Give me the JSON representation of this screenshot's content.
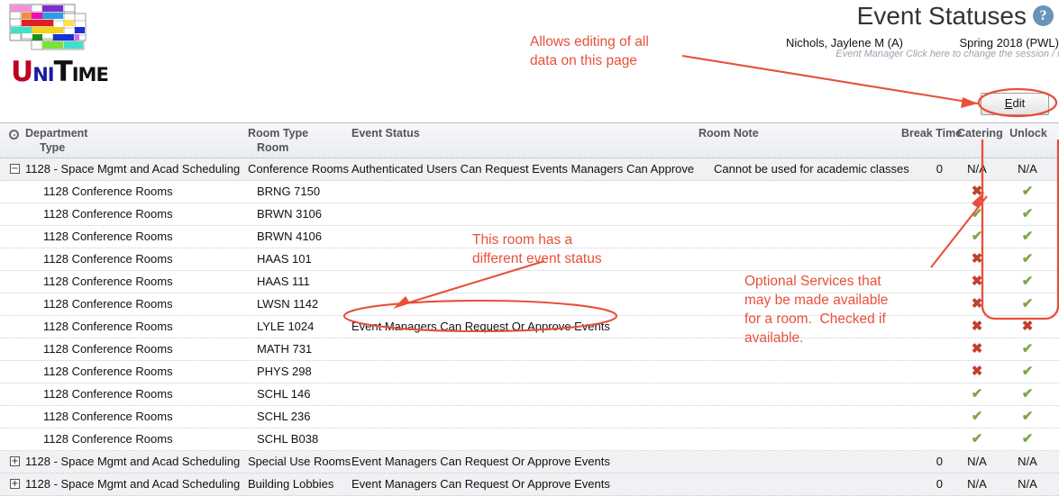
{
  "brand": {
    "name": "UniTime",
    "u": "U",
    "ni": "NI",
    "t": "T",
    "ime": "IME"
  },
  "header": {
    "title": "Event Statuses",
    "help_icon": "help-icon",
    "help_glyph": "?",
    "user_name": "Nichols, Jaylene M (A)",
    "user_role": "Event Manager",
    "session": "Spring 2018 (PWL)",
    "session_hint": "Click here to change the session / role."
  },
  "toolbar": {
    "edit_label": "Edit",
    "edit_accesskey": "E",
    "edit_rest": "dit"
  },
  "table": {
    "headers": {
      "department": "Department",
      "type": "Type",
      "room_type": "Room Type",
      "room": "Room",
      "event_status": "Event Status",
      "room_note": "Room Note",
      "break_time": "Break Time",
      "catering": "Catering",
      "unlock": "Unlock"
    },
    "groups": [
      {
        "expander": "−",
        "expanded": true,
        "label": "1128 - Space Mgmt and Acad Scheduling",
        "room_type": "Conference Rooms",
        "event_status": "Authenticated Users Can Request Events Managers Can Approve",
        "room_note": "Cannot be used for academic classes",
        "break_time": "0",
        "catering": "N/A",
        "unlock": "N/A",
        "rooms": [
          {
            "dept": "1128 Conference Rooms",
            "room": "BRNG 7150",
            "event_status": "",
            "room_note": "",
            "catering": "no",
            "unlock": "yes"
          },
          {
            "dept": "1128 Conference Rooms",
            "room": "BRWN 3106",
            "event_status": "",
            "room_note": "",
            "catering": "yes",
            "unlock": "yes"
          },
          {
            "dept": "1128 Conference Rooms",
            "room": "BRWN 4106",
            "event_status": "",
            "room_note": "",
            "catering": "yes",
            "unlock": "yes"
          },
          {
            "dept": "1128 Conference Rooms",
            "room": "HAAS 101",
            "event_status": "",
            "room_note": "",
            "catering": "no",
            "unlock": "yes"
          },
          {
            "dept": "1128 Conference Rooms",
            "room": "HAAS 111",
            "event_status": "",
            "room_note": "",
            "catering": "no",
            "unlock": "yes"
          },
          {
            "dept": "1128 Conference Rooms",
            "room": "LWSN 1142",
            "event_status": "",
            "room_note": "",
            "catering": "no",
            "unlock": "yes"
          },
          {
            "dept": "1128 Conference Rooms",
            "room": "LYLE 1024",
            "event_status": "Event Managers Can Request Or Approve Events",
            "room_note": "",
            "catering": "no",
            "unlock": "no"
          },
          {
            "dept": "1128 Conference Rooms",
            "room": "MATH 731",
            "event_status": "",
            "room_note": "",
            "catering": "no",
            "unlock": "yes"
          },
          {
            "dept": "1128 Conference Rooms",
            "room": "PHYS 298",
            "event_status": "",
            "room_note": "",
            "catering": "no",
            "unlock": "yes"
          },
          {
            "dept": "1128 Conference Rooms",
            "room": "SCHL 146",
            "event_status": "",
            "room_note": "",
            "catering": "yes",
            "unlock": "yes"
          },
          {
            "dept": "1128 Conference Rooms",
            "room": "SCHL 236",
            "event_status": "",
            "room_note": "",
            "catering": "yes",
            "unlock": "yes"
          },
          {
            "dept": "1128 Conference Rooms",
            "room": "SCHL B038",
            "event_status": "",
            "room_note": "",
            "catering": "yes",
            "unlock": "yes"
          }
        ]
      },
      {
        "expander": "+",
        "expanded": false,
        "label": "1128 - Space Mgmt and Acad Scheduling",
        "room_type": "Special Use Rooms",
        "event_status": "Event Managers Can Request Or Approve Events",
        "room_note": "",
        "break_time": "0",
        "catering": "N/A",
        "unlock": "N/A",
        "rooms": []
      },
      {
        "expander": "+",
        "expanded": false,
        "label": "1128 - Space Mgmt and Acad Scheduling",
        "room_type": "Building Lobbies",
        "event_status": "Event Managers Can Request Or Approve Events",
        "room_note": "",
        "break_time": "0",
        "catering": "N/A",
        "unlock": "N/A",
        "rooms": []
      }
    ],
    "marks": {
      "yes": "✔",
      "no": "✖"
    }
  },
  "annotations": {
    "edit_note": "Allows editing of all\ndata on this page",
    "status_note": "This room has a\ndifferent event status",
    "services_note": "Optional Services that\nmay be made available\nfor a room.  Checked if\navailable.",
    "color": "#e8503a"
  }
}
